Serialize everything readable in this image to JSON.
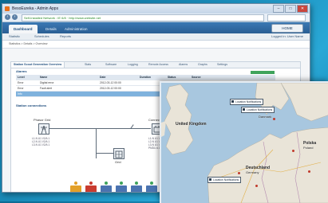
{
  "browser": {
    "title": "BesoEureka - Admin Apps",
    "tab_label": "",
    "url": "Self-Installed Network : IE 6/8 · http://www.website.net",
    "min_label": "–",
    "max_label": "□",
    "close_label": "✕"
  },
  "app": {
    "tabs": [
      "Dashboard",
      "Details",
      "Administration"
    ],
    "logout_label": "HOME",
    "subnav": [
      "Statistic",
      "Schedules",
      "Reports"
    ],
    "subnav_right": "Logged in: User Name",
    "breadcrumb": "Statistics > Details > Overview"
  },
  "content": {
    "tabs": [
      "Station Scout Generation Overview",
      "Stats",
      "Software",
      "Logging",
      "Remote Access",
      "Alarms",
      "Graphs",
      "Settings"
    ],
    "alarms_title": "Alarms",
    "table": {
      "headers": [
        "Level",
        "Name",
        "Date",
        "Duration",
        "Status",
        "Source"
      ],
      "rows": [
        [
          "Error",
          "Digital error",
          "2012-03-12 00:00",
          "",
          "",
          ""
        ],
        [
          "Error",
          "Fault alert",
          "2012-03-12 00:00",
          "",
          "",
          ""
        ],
        [
          "Info",
          "",
          "",
          "",
          "",
          ""
        ]
      ]
    },
    "diagram_title": "Station connections",
    "nodes": {
      "left": "Phasor Grid",
      "right": "Connector",
      "bottom": "Grid"
    },
    "left_values": [
      "L1-N  U1  V2/A  1",
      "L2-N  U1  V2/A  1",
      "L3-N  U1  V2/A  1"
    ],
    "right_values": [
      "L1-N  U1  V2/A  1",
      "L2-N  U1  V2/A  1",
      "L3-N  U1  V2/A  1",
      "PMDU  A 1 0 V"
    ]
  },
  "map": {
    "labels": [
      "United Kingdom",
      "Deutschland",
      "Germany",
      "Polska",
      "Poland",
      "Danmark"
    ],
    "callouts": [
      "Location Notifications",
      "Location Notifications",
      "Location Notifications"
    ]
  },
  "colors": {
    "status_tiles": [
      "#e3a028",
      "#c93b2f",
      "#4a73b0",
      "#4a73b0",
      "#4a73b0",
      "#4a73b0"
    ],
    "status_dots": [
      "#e3a028",
      "#c93b2f",
      "#3fa35b",
      "#3fa35b",
      "#3fa35b",
      "#3fa35b"
    ]
  }
}
